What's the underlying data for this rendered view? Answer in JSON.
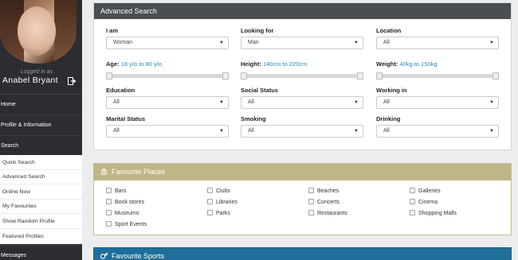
{
  "sidebar": {
    "logged_in": "Logged in as",
    "username": "Anabel Bryant",
    "nav": {
      "home": "Home",
      "profile": "Profile & Information",
      "search": "Search",
      "messages": "Messages"
    },
    "sub_items": [
      "Quick Search",
      "Advanced Search",
      "Online Now",
      "My Favourites",
      "Show Random Profile",
      "Featured Profiles"
    ]
  },
  "advanced_search": {
    "title": "Advanced Search",
    "i_am": {
      "label": "I am",
      "value": "Woman"
    },
    "looking_for": {
      "label": "Looking for",
      "value": "Man"
    },
    "location": {
      "label": "Location",
      "value": "All"
    },
    "age": {
      "label": "Age:",
      "range": "18 y/o to 80 y/o"
    },
    "height": {
      "label": "Height:",
      "range": "140cm to 220cm"
    },
    "weight": {
      "label": "Weight:",
      "range": "40kg to 150kg"
    },
    "education": {
      "label": "Education",
      "value": "All"
    },
    "social_status": {
      "label": "Social Status",
      "value": "All"
    },
    "working_in": {
      "label": "Working in",
      "value": "All"
    },
    "marital_status": {
      "label": "Marital Status",
      "value": "All"
    },
    "smoking": {
      "label": "Smoking",
      "value": "All"
    },
    "drinking": {
      "label": "Drinking",
      "value": "All"
    }
  },
  "favourite_places": {
    "title": "Favourite Places",
    "items": [
      "Bars",
      "Clubs",
      "Beaches",
      "Galleries",
      "Book stores",
      "Libraries",
      "Concerts",
      "Cinema",
      "Museums",
      "Parks",
      "Restaurants",
      "Shopping Malls",
      "Sport Events"
    ]
  },
  "favourite_sports": {
    "title": "Favourite Sports"
  },
  "colors": {
    "sidebar": "#2b2d30",
    "adv_header": "#4a4d52",
    "places_header": "#bdb686",
    "sports_header": "#1f6f9a",
    "accent": "#2a8ab8"
  }
}
